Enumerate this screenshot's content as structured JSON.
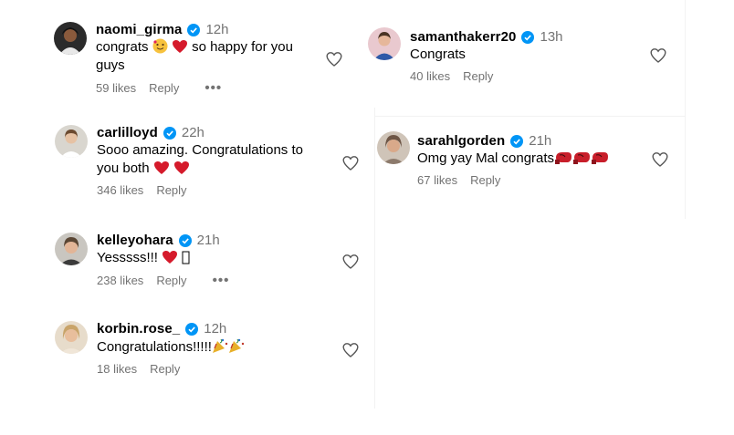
{
  "comments_left": [
    {
      "username": "naomi_girma",
      "time": "12h",
      "text": "congrats",
      "text2": "so happy for you",
      "text3": "guys",
      "likes": "59 likes",
      "reply": "Reply",
      "more": "•••"
    },
    {
      "username": "carlilloyd",
      "time": "22h",
      "text": "Sooo amazing. Congratulations to",
      "text2": "you both",
      "likes": "346 likes",
      "reply": "Reply"
    },
    {
      "username": "kelleyohara",
      "time": "21h",
      "text": "Yesssss!!!",
      "likes": "238 likes",
      "reply": "Reply",
      "more": "•••"
    },
    {
      "username": "korbin.rose_",
      "time": "12h",
      "text": "Congratulations!!!!!",
      "likes": "18 likes",
      "reply": "Reply"
    }
  ],
  "comments_right": [
    {
      "username": "samanthakerr20",
      "time": "13h",
      "text": "Congrats",
      "likes": "40 likes",
      "reply": "Reply"
    },
    {
      "username": "sarahlgorden",
      "time": "21h",
      "text": "Omg yay Mal congrats",
      "likes": "67 likes",
      "reply": "Reply"
    }
  ],
  "colors": {
    "verified": "#0095f6",
    "meta": "#737373",
    "heart": "#e0245e"
  },
  "icons": {
    "like": "heart-outline-icon",
    "verified": "verified-badge-icon",
    "more": "more-options-icon"
  }
}
